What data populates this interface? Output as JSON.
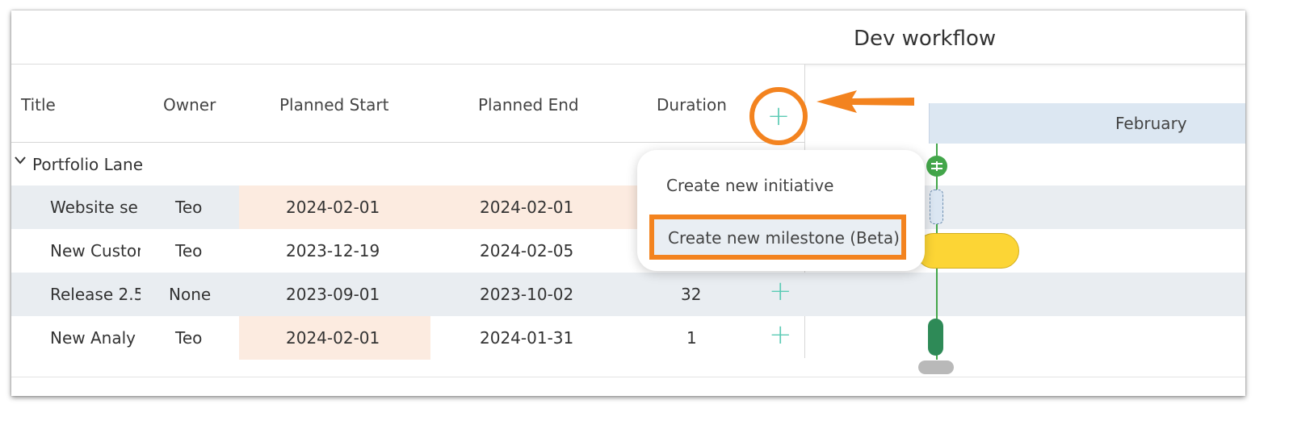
{
  "workflow_title": "Dev workflow",
  "columns": {
    "title": "Title",
    "owner": "Owner",
    "planned_start": "Planned Start",
    "planned_end": "Planned End",
    "duration": "Duration",
    "add_icon": "plus-icon"
  },
  "add_symbol": "+",
  "timeline": {
    "month": "February"
  },
  "group": {
    "label": "Portfolio Lane",
    "collapse_icon": "chevron-down-icon"
  },
  "rows": [
    {
      "title": "Website se",
      "owner": "Teo",
      "start": "2024-02-01",
      "end": "2024-02-01",
      "duration": ""
    },
    {
      "title": "New Custor",
      "owner": "Teo",
      "start": "2023-12-19",
      "end": "2024-02-05",
      "duration": ""
    },
    {
      "title": "Release 2.5",
      "owner": "None",
      "start": "2023-09-01",
      "end": "2023-10-02",
      "duration": "32"
    },
    {
      "title": "New Analy",
      "owner": "Teo",
      "start": "2024-02-01",
      "end": "2024-01-31",
      "duration": "1"
    }
  ],
  "menu": {
    "create_initiative": "Create new initiative",
    "create_milestone": "Create new milestone (Beta)"
  },
  "colors": {
    "accent_orange": "#f3831f",
    "plus_teal": "#5ccbb5",
    "today_green": "#43a64a",
    "bar_yellow": "#fcd535",
    "milestone_green": "#2e8a57",
    "month_band": "#dce7f2",
    "date_highlight": "#fcebe0"
  }
}
